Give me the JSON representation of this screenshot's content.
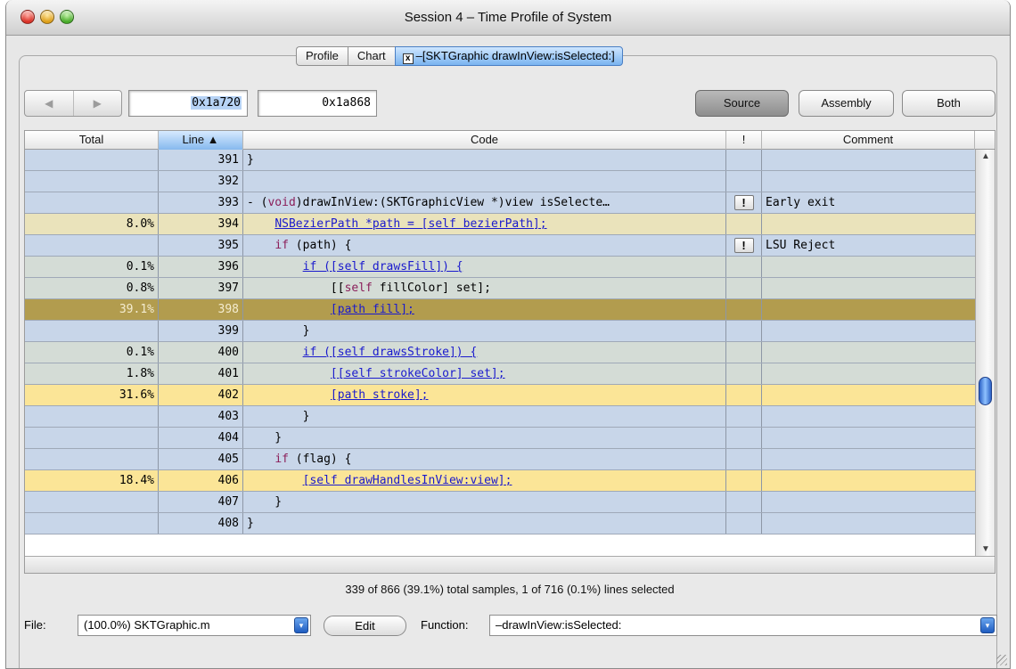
{
  "window": {
    "title": "Session 4 – Time Profile of System"
  },
  "tabs": [
    {
      "label": "Profile"
    },
    {
      "label": "Chart"
    },
    {
      "label": "–[SKTGraphic drawInView:isSelected:]",
      "close_label": "x"
    }
  ],
  "toolbar": {
    "back_icon": "◀",
    "forward_icon": "▶",
    "start_address": "0x1a720",
    "end_address": "0x1a868",
    "source_label": "Source",
    "assembly_label": "Assembly",
    "both_label": "Both"
  },
  "table": {
    "columns": [
      "Total",
      "Line ▲",
      "Code",
      "!",
      "Comment"
    ],
    "rows": [
      {
        "total": "",
        "line": "391",
        "code": [
          {
            "t": "}"
          }
        ],
        "bang": "",
        "comment": "",
        "tint": "blue"
      },
      {
        "total": "",
        "line": "392",
        "code": [],
        "bang": "",
        "comment": "",
        "tint": "blue"
      },
      {
        "total": "",
        "line": "393",
        "code": [
          {
            "t": "- ("
          },
          {
            "t": "void",
            "k": "kw"
          },
          {
            "t": ")drawInView:(SKTGraphicView *)view isSelecte…"
          }
        ],
        "bang": "!",
        "comment": "Early exit",
        "tint": "blue"
      },
      {
        "total": "8.0%",
        "line": "394",
        "code": [
          {
            "t": "    "
          },
          {
            "t": "NSBezierPath *path = [self bezierPath];",
            "k": "lnk"
          }
        ],
        "bang": "",
        "comment": "",
        "tint": "tan"
      },
      {
        "total": "",
        "line": "395",
        "code": [
          {
            "t": "    "
          },
          {
            "t": "if",
            "k": "kw"
          },
          {
            "t": " (path) {"
          }
        ],
        "bang": "!",
        "comment": "LSU Reject",
        "tint": "blue"
      },
      {
        "total": "0.1%",
        "line": "396",
        "code": [
          {
            "t": "        "
          },
          {
            "t": "if ([self drawsFill]) {",
            "k": "lnk"
          }
        ],
        "bang": "",
        "comment": "",
        "tint": "gray"
      },
      {
        "total": "0.8%",
        "line": "397",
        "code": [
          {
            "t": "            [["
          },
          {
            "t": "self",
            "k": "kw"
          },
          {
            "t": " fillColor] set];"
          }
        ],
        "bang": "",
        "comment": "",
        "tint": "gray"
      },
      {
        "total": "39.1%",
        "line": "398",
        "code": [
          {
            "t": "            "
          },
          {
            "t": "[path fill];",
            "k": "lnk"
          }
        ],
        "bang": "",
        "comment": "",
        "tint": "dark"
      },
      {
        "total": "",
        "line": "399",
        "code": [
          {
            "t": "        }"
          }
        ],
        "bang": "",
        "comment": "",
        "tint": "blue"
      },
      {
        "total": "0.1%",
        "line": "400",
        "code": [
          {
            "t": "        "
          },
          {
            "t": "if ([self drawsStroke]) {",
            "k": "lnk"
          }
        ],
        "bang": "",
        "comment": "",
        "tint": "gray"
      },
      {
        "total": "1.8%",
        "line": "401",
        "code": [
          {
            "t": "            "
          },
          {
            "t": "[[self strokeColor] set];",
            "k": "lnk"
          }
        ],
        "bang": "",
        "comment": "",
        "tint": "gray"
      },
      {
        "total": "31.6%",
        "line": "402",
        "code": [
          {
            "t": "            "
          },
          {
            "t": "[path stroke];",
            "k": "lnk"
          }
        ],
        "bang": "",
        "comment": "",
        "tint": "yellow"
      },
      {
        "total": "",
        "line": "403",
        "code": [
          {
            "t": "        }"
          }
        ],
        "bang": "",
        "comment": "",
        "tint": "blue"
      },
      {
        "total": "",
        "line": "404",
        "code": [
          {
            "t": "    }"
          }
        ],
        "bang": "",
        "comment": "",
        "tint": "blue"
      },
      {
        "total": "",
        "line": "405",
        "code": [
          {
            "t": "    "
          },
          {
            "t": "if",
            "k": "kw"
          },
          {
            "t": " (flag) {"
          }
        ],
        "bang": "",
        "comment": "",
        "tint": "blue"
      },
      {
        "total": "18.4%",
        "line": "406",
        "code": [
          {
            "t": "        "
          },
          {
            "t": "[self drawHandlesInView:view];",
            "k": "lnk"
          }
        ],
        "bang": "",
        "comment": "",
        "tint": "yellow"
      },
      {
        "total": "",
        "line": "407",
        "code": [
          {
            "t": "    }"
          }
        ],
        "bang": "",
        "comment": "",
        "tint": "blue"
      },
      {
        "total": "",
        "line": "408",
        "code": [
          {
            "t": "}"
          }
        ],
        "bang": "",
        "comment": "",
        "tint": "blue"
      }
    ]
  },
  "status": "339 of 866 (39.1%) total samples, 1 of 716 (0.1%) lines selected",
  "bottom": {
    "file_label": "File:",
    "file_value": "(100.0%) SKTGraphic.m",
    "edit_label": "Edit",
    "function_label": "Function:",
    "function_value": "–drawInView:isSelected:"
  },
  "colors": {
    "row_blue": "#c8d6e9",
    "row_tan": "#eae3bb",
    "row_gray": "#d4dcd6",
    "row_dark": "#b29c4e",
    "row_yellow": "#fbe597",
    "link": "#1a1acd",
    "keyword": "#8b1f5a"
  }
}
